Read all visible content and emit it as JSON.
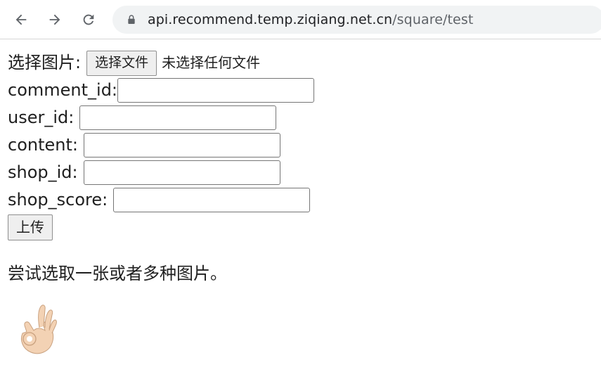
{
  "browser": {
    "url_host": "api.recommend.temp.ziqiang.net.cn",
    "url_path": "/square/test",
    "icons": {
      "back": "arrow-left-icon",
      "forward": "arrow-right-icon",
      "reload": "reload-icon",
      "lock": "lock-icon"
    }
  },
  "form": {
    "image_label": "选择图片:",
    "file_button_label": "选择文件",
    "file_status": "未选择任何文件",
    "fields": {
      "comment_id": {
        "label": "comment_id:",
        "value": ""
      },
      "user_id": {
        "label": "user_id:",
        "value": ""
      },
      "content": {
        "label": "content:",
        "value": ""
      },
      "shop_id": {
        "label": "shop_id:",
        "value": ""
      },
      "shop_score": {
        "label": "shop_score:",
        "value": ""
      }
    },
    "submit_label": "上传"
  },
  "preview": {
    "hint": "尝试选取一张或者多种图片。",
    "image_icon": "ok-hand-icon"
  }
}
